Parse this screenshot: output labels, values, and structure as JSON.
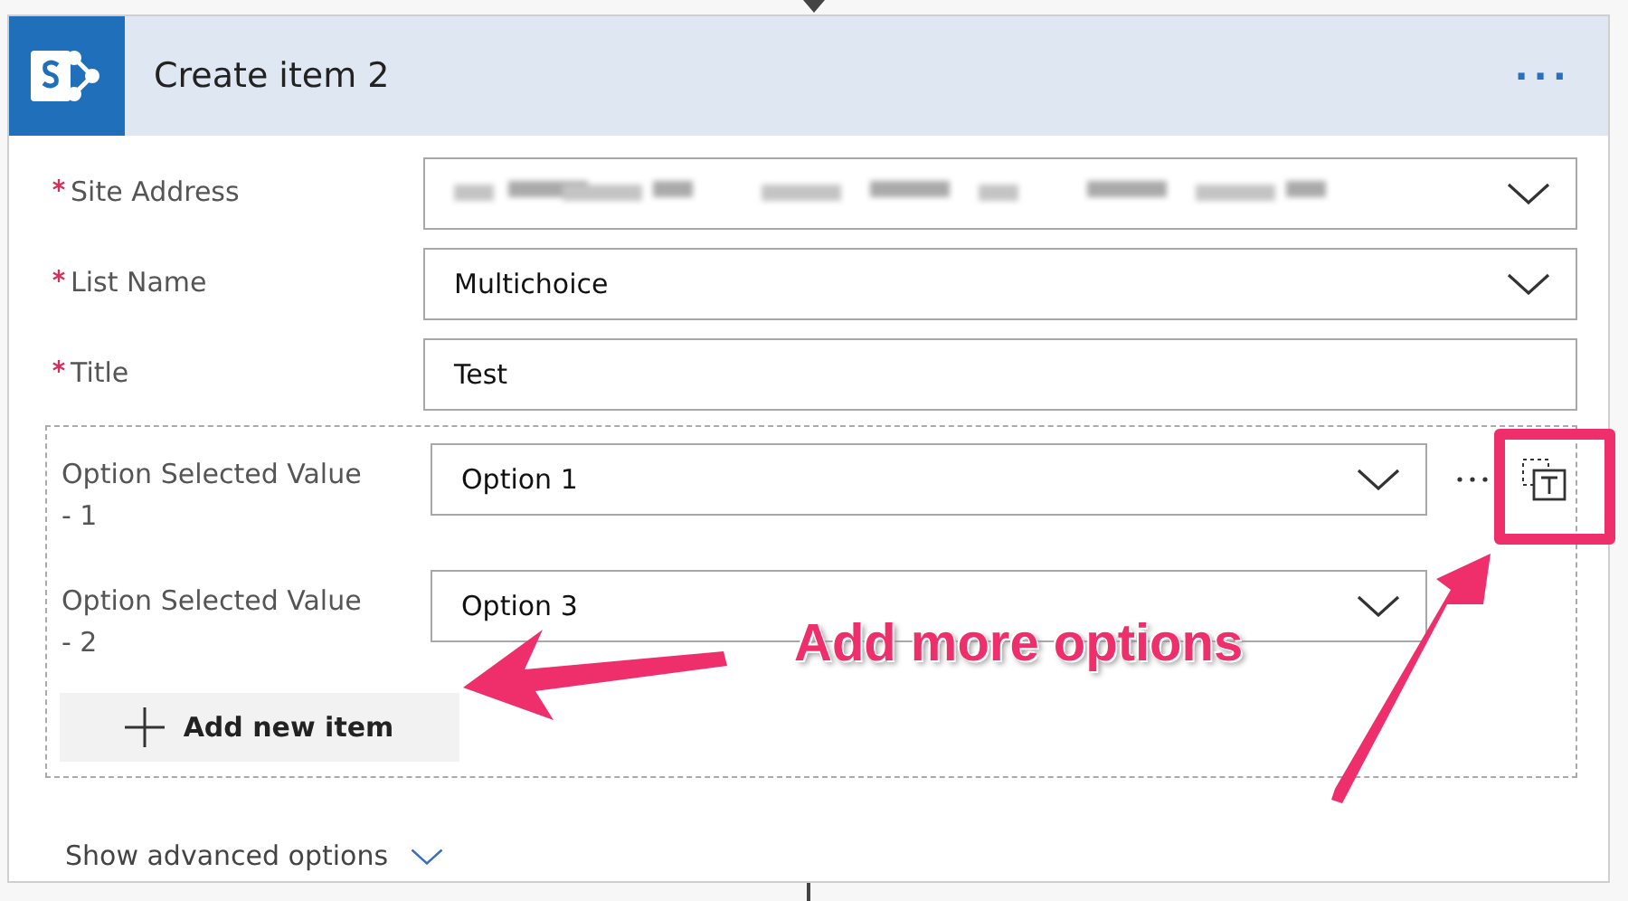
{
  "card": {
    "title": "Create item 2",
    "menu": "..."
  },
  "fields": [
    {
      "label": "Site Address",
      "required": true,
      "kind": "dropdown",
      "redacted": true
    },
    {
      "label": "List Name",
      "required": true,
      "kind": "dropdown",
      "value": "Multichoice"
    },
    {
      "label": "Title",
      "required": true,
      "kind": "text",
      "value": "Test"
    }
  ],
  "array_fields": [
    {
      "label": "Option Selected Value - 1",
      "value": "Option 1",
      "actions_visible": true
    },
    {
      "label": "Option Selected Value - 2",
      "value": "Option 3",
      "actions_visible": false
    }
  ],
  "add_button": {
    "label": "Add new item"
  },
  "advanced_link": {
    "label": "Show advanced options"
  },
  "annotation": {
    "text": "Add more options"
  }
}
